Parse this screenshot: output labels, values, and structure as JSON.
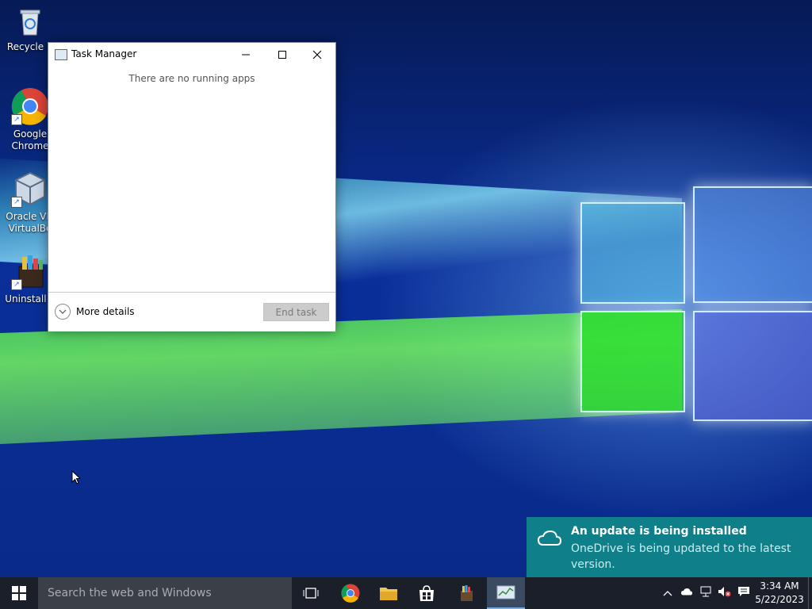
{
  "desktop": {
    "icons": [
      {
        "label": "Recycle B",
        "icon": "recycle-bin-icon"
      },
      {
        "label": "Google Chrome",
        "icon": "chrome-icon"
      },
      {
        "label": "Oracle VM VirtualBo",
        "icon": "virtualbox-icon"
      },
      {
        "label": "Uninstall T",
        "icon": "uninstall-icon"
      }
    ]
  },
  "task_manager": {
    "title": "Task Manager",
    "empty_message": "There are no running apps",
    "more_details_label": "More details",
    "end_task_label": "End task"
  },
  "toast": {
    "title": "An update is being installed",
    "body": "OneDrive is being updated to the latest version."
  },
  "taskbar": {
    "search_placeholder": "Search the web and Windows",
    "time": "3:34 AM",
    "date": "5/22/2023"
  },
  "colors": {
    "taskbar": "#1a1f2a",
    "toast": "#0f7f8a",
    "search_box": "#3b3f48"
  }
}
